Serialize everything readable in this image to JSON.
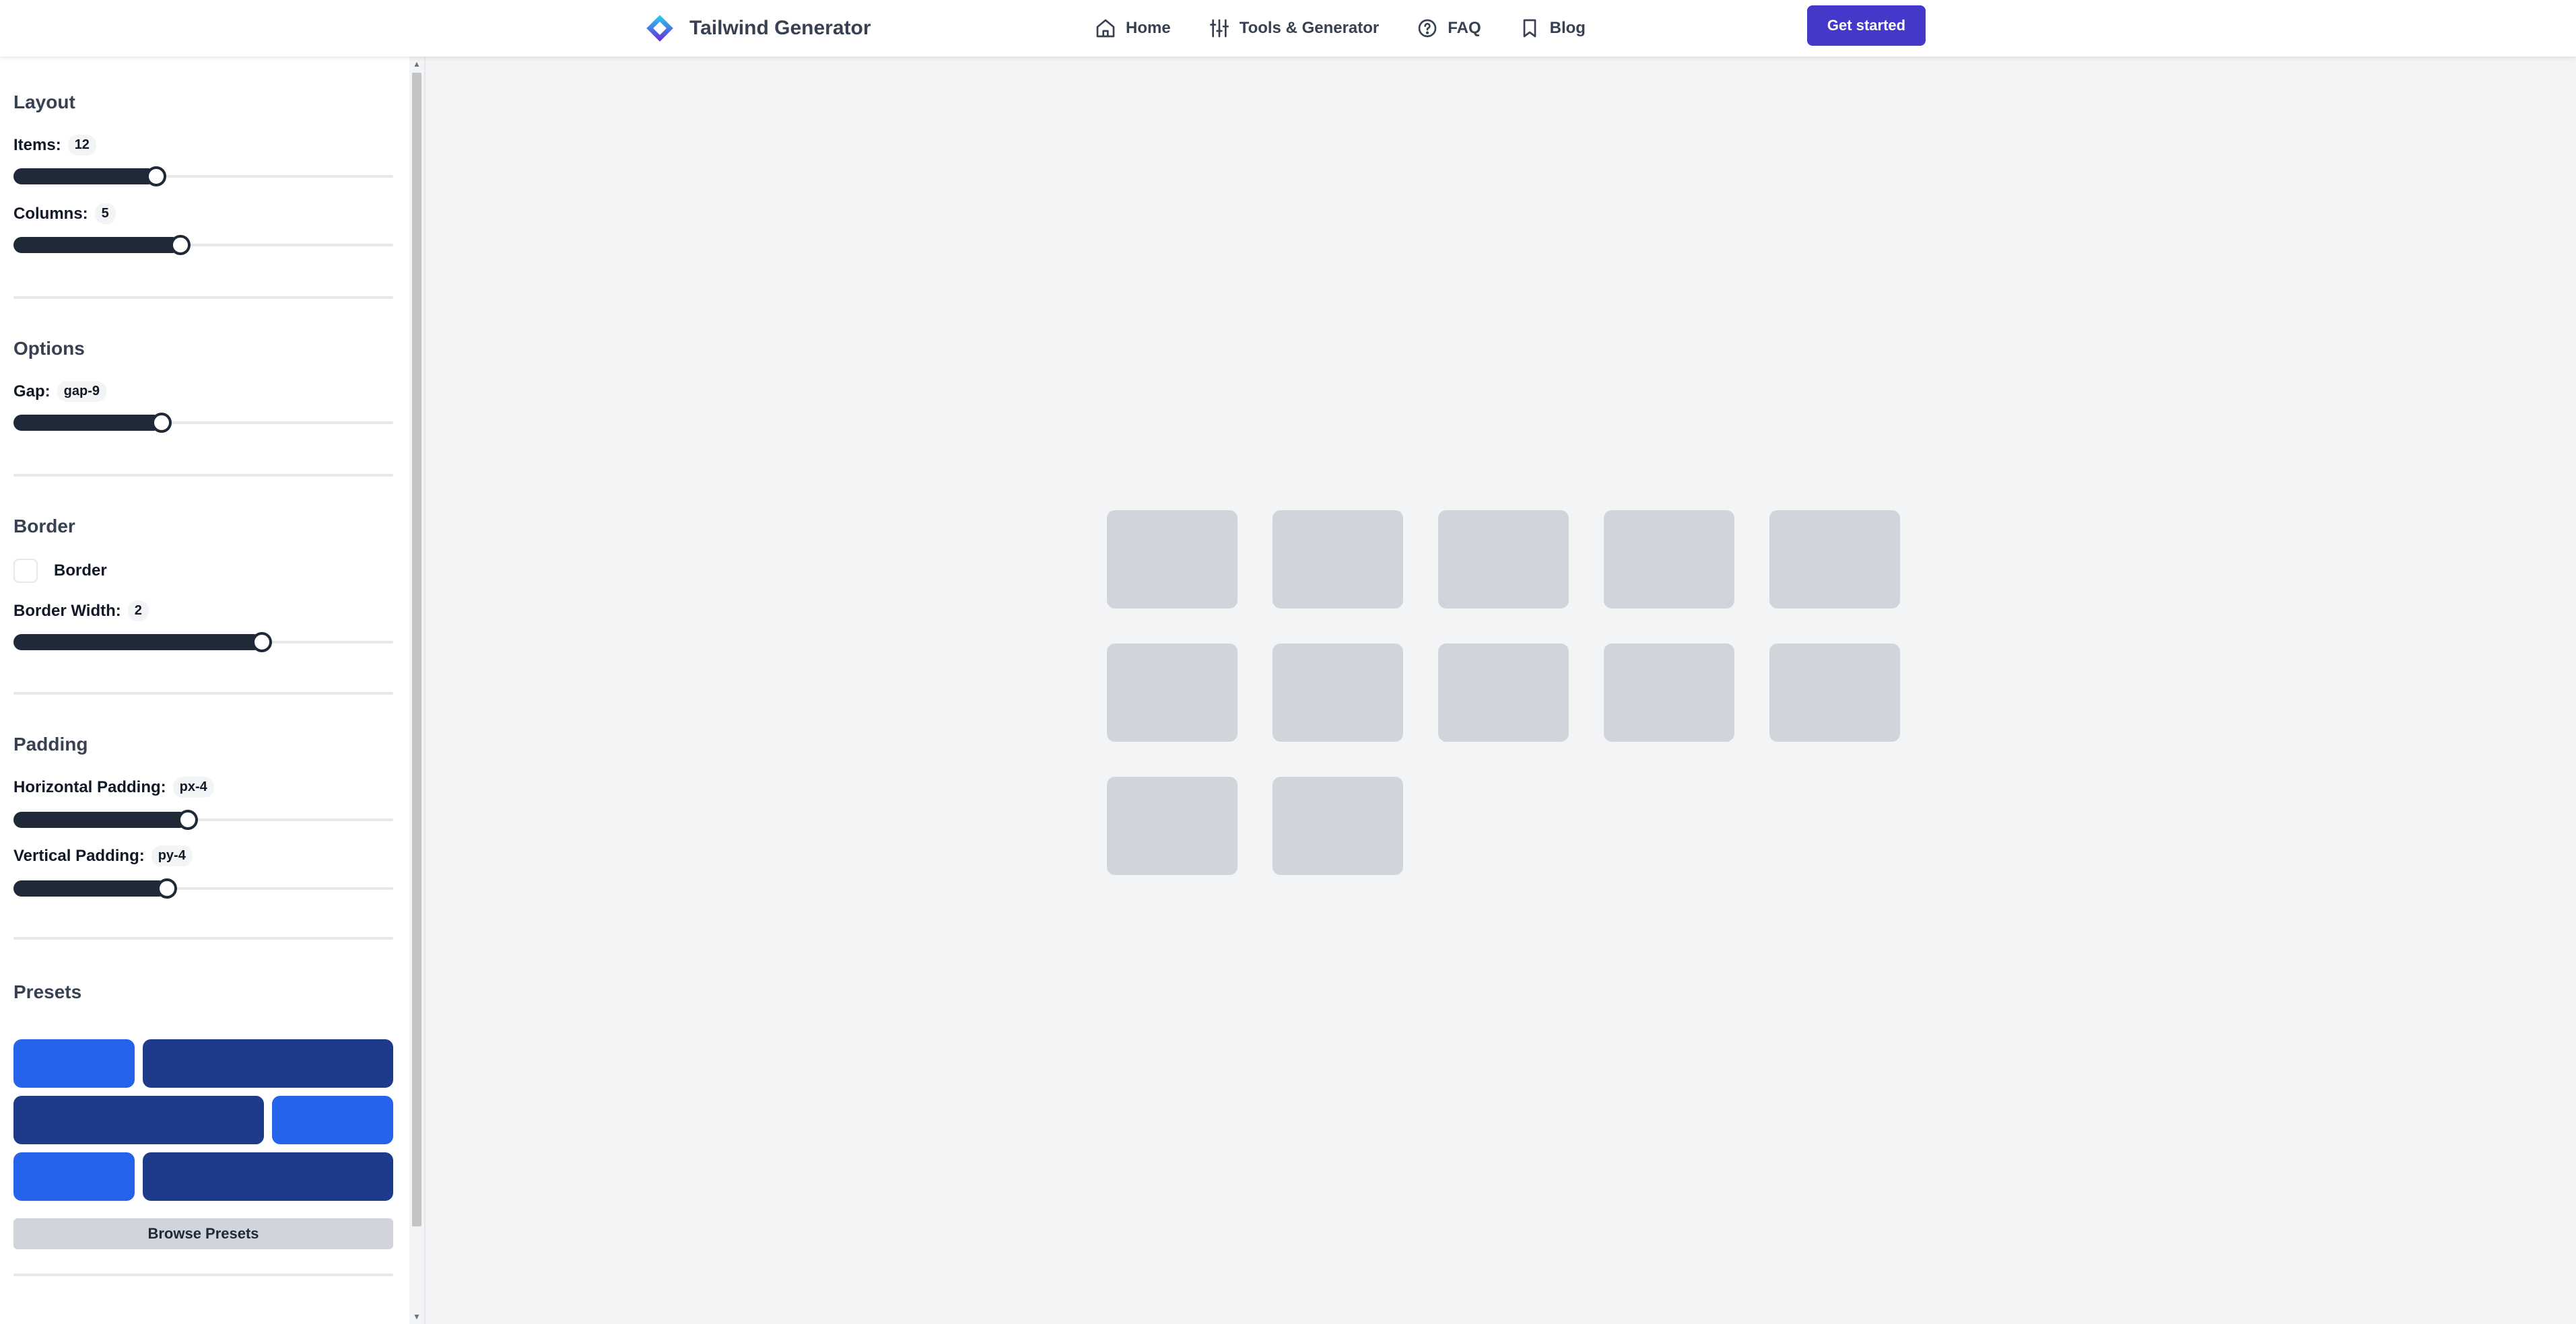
{
  "header": {
    "brand_name": "Tailwind Generator",
    "nav": [
      {
        "label": "Home",
        "icon": "home-icon"
      },
      {
        "label": "Tools & Generator",
        "icon": "sliders-icon"
      },
      {
        "label": "FAQ",
        "icon": "question-circle-icon"
      },
      {
        "label": "Blog",
        "icon": "bookmark-icon"
      }
    ],
    "cta_label": "Get started"
  },
  "sidebar": {
    "layout": {
      "title": "Layout",
      "items": {
        "label": "Items:",
        "value": "12",
        "level": 0.375
      },
      "columns": {
        "label": "Columns:",
        "value": "5",
        "level": 0.44
      }
    },
    "options": {
      "title": "Options",
      "gap": {
        "label": "Gap:",
        "value": "gap-9",
        "level": 0.39
      }
    },
    "border": {
      "title": "Border",
      "checkbox_label": "Border",
      "checked": false,
      "width": {
        "label": "Border Width:",
        "value": "2",
        "level": 0.655
      }
    },
    "padding": {
      "title": "Padding",
      "horizontal": {
        "label": "Horizontal Padding:",
        "value": "px-4",
        "level": 0.46
      },
      "vertical": {
        "label": "Vertical Padding:",
        "value": "py-4",
        "level": 0.405
      }
    },
    "presets": {
      "title": "Presets",
      "browse_label": "Browse Presets"
    }
  },
  "preview": {
    "item_count": 12,
    "columns": 5
  },
  "colors": {
    "accent": "#4338ca",
    "slider_fill": "#1f2937",
    "preset_light": "#2563eb",
    "preset_dark": "#1e3a8a",
    "preview_item": "#d1d5db",
    "preview_bg": "#f3f4f6"
  }
}
